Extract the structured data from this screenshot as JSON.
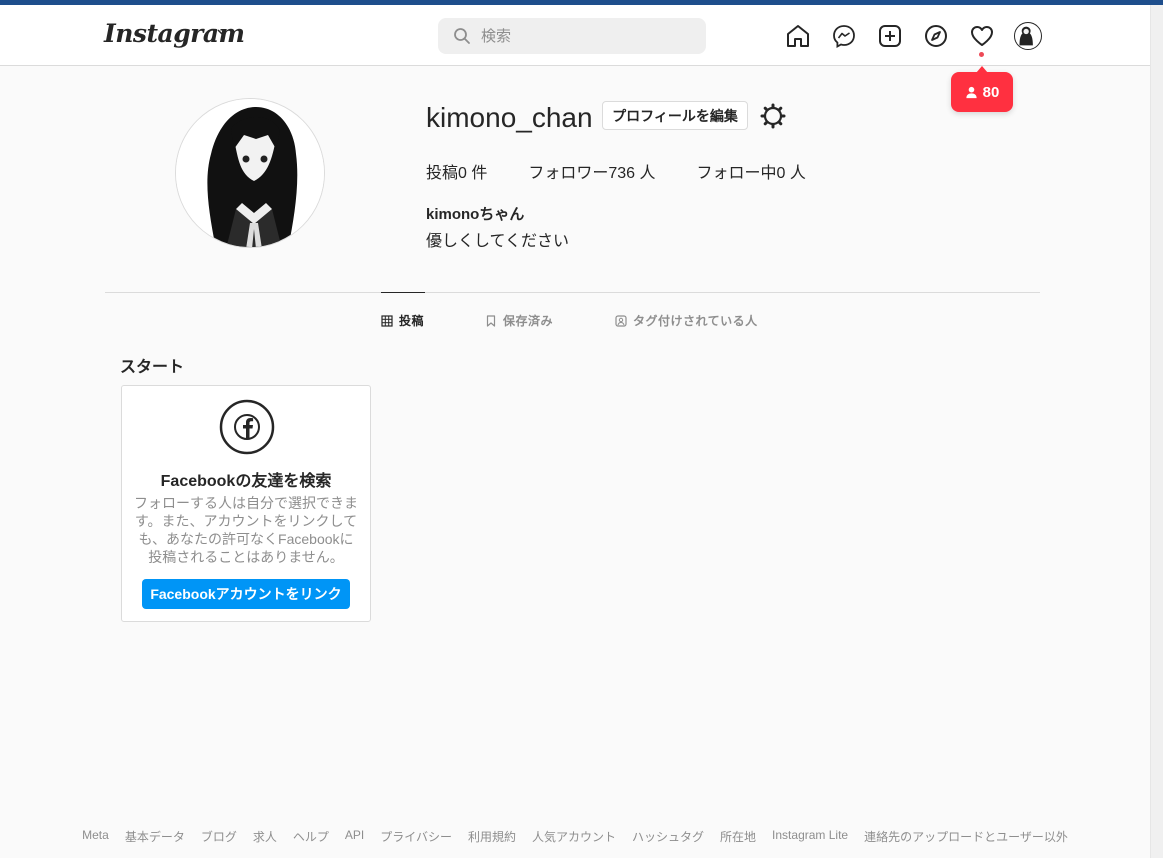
{
  "header": {
    "logo_text": "Instagram",
    "search_placeholder": "検索",
    "notification_count": "80"
  },
  "profile": {
    "username": "kimono_chan",
    "edit_button": "プロフィールを編集",
    "stats": {
      "posts": "投稿0 件",
      "followers": "フォロワー736 人",
      "following": "フォロー中0 人"
    },
    "full_name": "kimonoちゃん",
    "bio": "優しくしてください"
  },
  "tabs": [
    {
      "label": "投稿",
      "active": true
    },
    {
      "label": "保存済み",
      "active": false
    },
    {
      "label": "タグ付けされている人",
      "active": false
    }
  ],
  "start": {
    "title": "スタート",
    "card": {
      "title": "Facebookの友達を検索",
      "description": "フォローする人は自分で選択できます。また、アカウントをリンクしても、あなたの許可なくFacebookに投稿されることはありません。",
      "button": "Facebookアカウントをリンク"
    }
  },
  "footer": {
    "links": [
      "Meta",
      "基本データ",
      "ブログ",
      "求人",
      "ヘルプ",
      "API",
      "プライバシー",
      "利用規約",
      "人気アカウント",
      "ハッシュタグ",
      "所在地",
      "Instagram Lite",
      "連絡先のアップロードとユーザー以外"
    ]
  },
  "colors": {
    "accent_blue": "#0095f6",
    "notification_red": "#ff3040",
    "text_primary": "#262626",
    "text_secondary": "#8e8e8e"
  }
}
